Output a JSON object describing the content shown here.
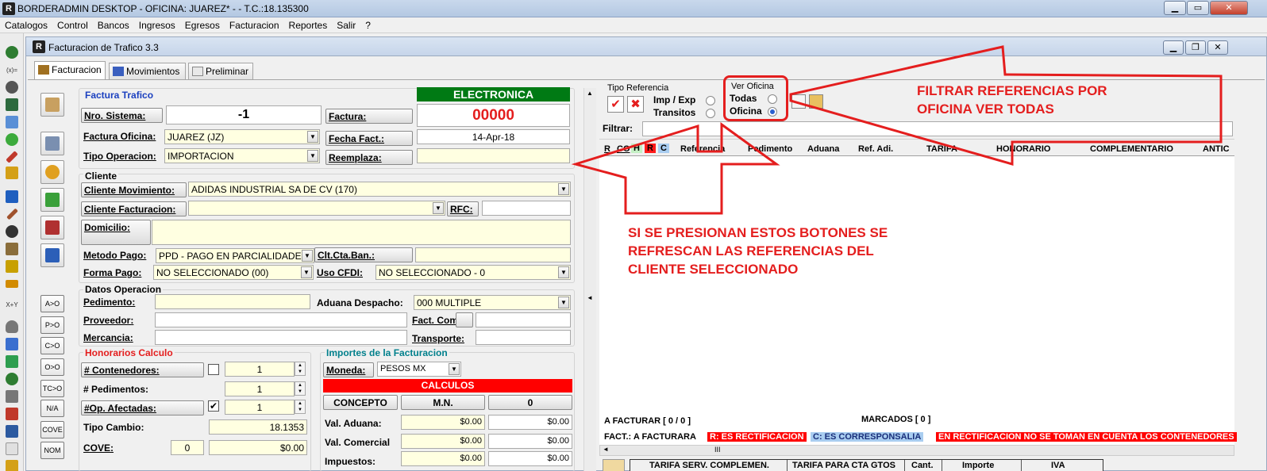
{
  "window": {
    "title": "BORDERADMIN DESKTOP - OFICINA: JUAREZ* -  - T.C.:18.135300",
    "app_icon": "R"
  },
  "menu": [
    "Catalogos",
    "Control",
    "Bancos",
    "Ingresos",
    "Egresos",
    "Facturacion",
    "Reportes",
    "Salir",
    "?"
  ],
  "left_toolbar": {
    "texts": [
      "(x)=",
      "X+Y",
      "A>O",
      "P>O",
      "C>O",
      "O>O",
      "TC>O",
      "N/A",
      "COVE",
      "NOM"
    ]
  },
  "inner_window": {
    "title": "Facturacion de Trafico 3.3"
  },
  "tabs": [
    "Facturacion",
    "Movimientos",
    "Preliminar"
  ],
  "factura": {
    "group_title": "Factura Trafico",
    "badge": "ELECTRONICA",
    "nro_sistema_label": "Nro. Sistema:",
    "nro_sistema_value": "-1",
    "factura_label": "Factura:",
    "factura_value": "00000",
    "factura_oficina_label": "Factura Oficina:",
    "factura_oficina_value": "JUAREZ (JZ)",
    "fecha_label": "Fecha Fact.:",
    "fecha_value": "14-Apr-18",
    "tipo_operacion_label": "Tipo Operacion:",
    "tipo_operacion_value": "IMPORTACION",
    "reemplaza_label": "Reemplaza:"
  },
  "cliente": {
    "group_title": "Cliente",
    "movimiento_label": "Cliente Movimiento:",
    "movimiento_value": "ADIDAS INDUSTRIAL SA DE CV (170)",
    "facturacion_label": "Cliente Facturacion:",
    "rfc_label": "RFC:",
    "domicilio_label": "Domicilio:",
    "metodo_pago_label": "Metodo Pago:",
    "metodo_pago_value": "PPD - PAGO EN PARCIALIDADES",
    "cta_ban_label": "Clt.Cta.Ban.:",
    "forma_pago_label": "Forma Pago:",
    "forma_pago_value": "NO SELECCIONADO (00)",
    "uso_cfdi_label": "Uso CFDI:",
    "uso_cfdi_value": "NO SELECCIONADO - 0"
  },
  "datos": {
    "group_title": "Datos Operacion",
    "pedimento_label": "Pedimento:",
    "aduana_label": "Aduana Despacho:",
    "aduana_value": "000 MULTIPLE",
    "proveedor_label": "Proveedor:",
    "fact_com_label": "Fact. Com.:",
    "mercancia_label": "Mercancia:",
    "transporte_label": "Transporte:"
  },
  "honorarios": {
    "group_title": "Honorarios Calculo",
    "contenedores_label": "# Contenedores:",
    "contenedores_value": "1",
    "pedimentos_label": "# Pedimentos:",
    "pedimentos_value": "1",
    "op_label": "#Op. Afectadas:",
    "op_value": "1",
    "op_check": "✔",
    "tipo_cambio_label": "Tipo Cambio:",
    "tipo_cambio_value": "18.1353",
    "cove_label": "COVE:",
    "cove_count": "0",
    "cove_amount": "$0.00"
  },
  "importes": {
    "group_title": "Importes de la Facturacion",
    "moneda_label": "Moneda:",
    "moneda_value": "PESOS MX",
    "calculos": "CALCULOS",
    "col_concepto": "CONCEPTO",
    "col_mn": "M.N.",
    "col_other": "0",
    "rows": [
      {
        "label": "Val. Aduana:",
        "mn": "$0.00",
        "other": "$0.00"
      },
      {
        "label": "Val. Comercial",
        "mn": "$0.00",
        "other": "$0.00"
      },
      {
        "label": "Impuestos:",
        "mn": "$0.00",
        "other": "$0.00"
      }
    ]
  },
  "right": {
    "tipo_referencia_title": "Tipo Referencia",
    "imp_exp": "Imp / Exp",
    "transitos": "Transitos",
    "ver_oficina_title": "Ver Oficina",
    "todas": "Todas",
    "oficina": "Oficina",
    "filtrar_label": "Filtrar:",
    "flag_cols": [
      "R",
      "CO",
      "H",
      "R",
      "C"
    ],
    "columns": [
      "Referencia",
      "Pedimento",
      "Aduana",
      "Ref. Adi.",
      "TARIFA",
      "HONORARIO",
      "COMPLEMENTARIO",
      "ANTIC"
    ],
    "a_facturar": "A FACTURAR [ 0 / 0 ]",
    "marcados": "MARCADOS [ 0 ]",
    "legend_a_facturar": "FACT.: A FACTURARA",
    "legend_r": "R: ES RECTIFICACION",
    "legend_c": "C: ES CORRESPONSALIA",
    "legend_warning": "EN RECTIFICACION NO SE TOMAN EN CUENTA LOS CONTENEDORES",
    "scroll_grip": "III",
    "bottom_columns": [
      "TARIFA SERV. COMPLEMEN.",
      "TARIFA PARA CTA GTOS",
      "Cant.",
      "Importe",
      "IVA"
    ]
  },
  "annotations": {
    "top_line1": "FILTRAR REFERENCIAS POR",
    "top_line2": "OFICINA  VER TODAS",
    "mid_line1": "SI SE PRESIONAN ESTOS BOTONES SE",
    "mid_line2": "REFRESCAN LAS REFERENCIAS DEL",
    "mid_line3": "CLIENTE SELECCIONADO"
  },
  "colors": {
    "accent_red": "#e41e1e",
    "badge_green": "#007a14",
    "legend_red_bg": "#ff0000",
    "legend_blue_bg": "#a9cdf0",
    "header_blue": "#1a3fbf",
    "teal": "#00808c"
  }
}
